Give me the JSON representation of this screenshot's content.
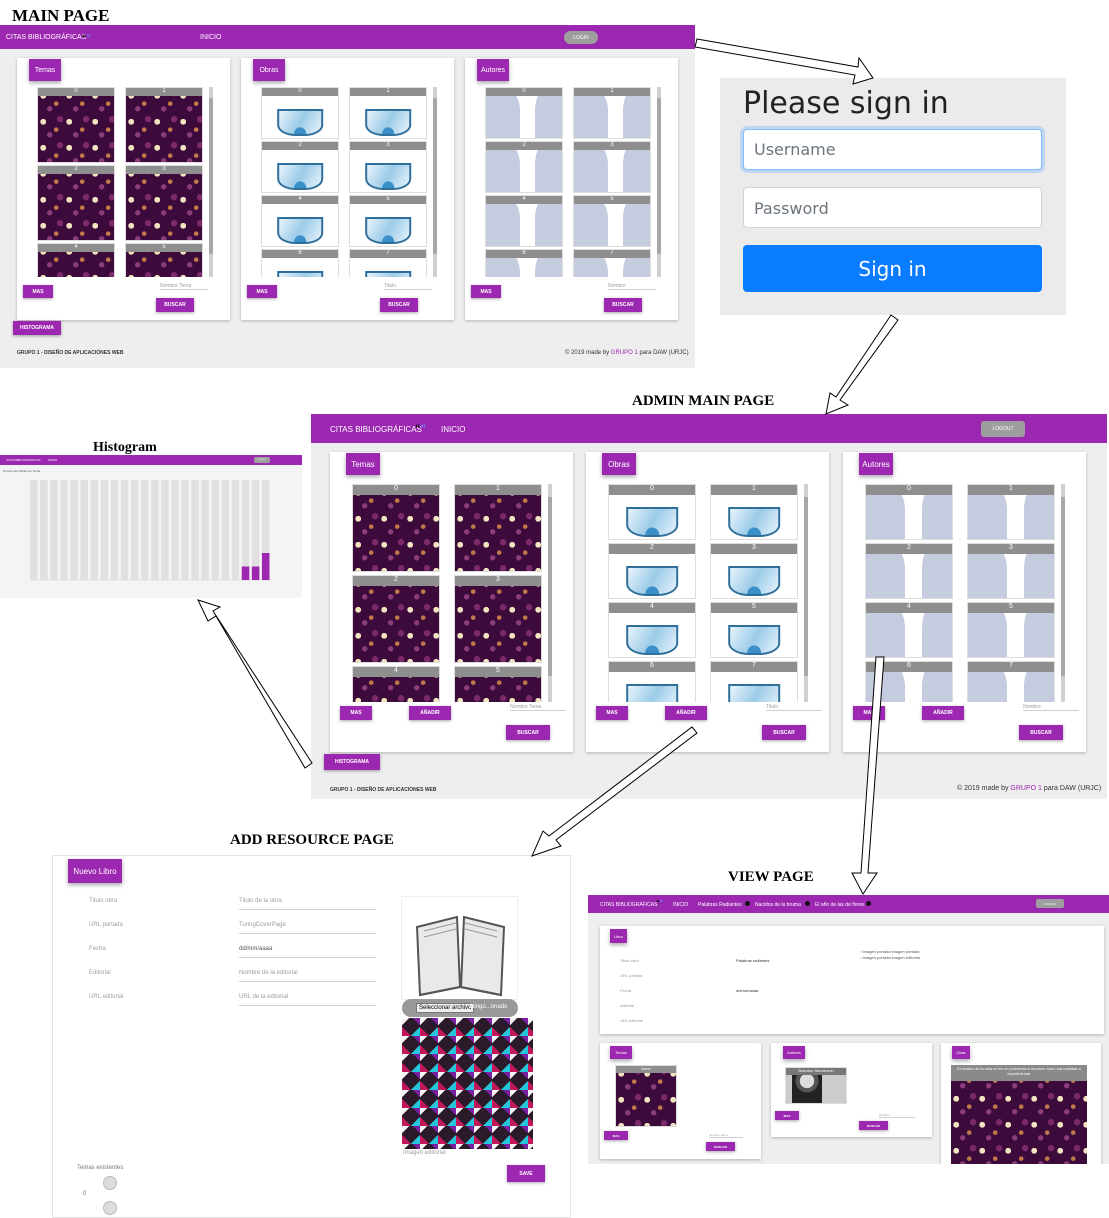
{
  "captions": {
    "main": "MAIN PAGE",
    "admin": "ADMIN MAIN PAGE",
    "histogram": "Histogram",
    "add": "ADD RESOURCE PAGE",
    "view": "VIEW PAGE"
  },
  "main_page": {
    "brand": "CITAS BIBLIOGRÁFICAS",
    "quote_open": "“",
    "quote_close": "”",
    "nav_inicio": "INICIO",
    "login": "LOGIN",
    "cards": [
      {
        "chip": "Temas",
        "more": "MAS",
        "placeholder": "Nombre Tema",
        "search": "BUSCAR",
        "tiles": [
          "0",
          "1",
          "2",
          "3",
          "4",
          "5"
        ]
      },
      {
        "chip": "Obras",
        "more": "MAS",
        "placeholder": "Titulo",
        "search": "BUSCAR",
        "tiles": [
          "0",
          "1",
          "2",
          "3",
          "4",
          "5",
          "6",
          "7"
        ]
      },
      {
        "chip": "Autores",
        "more": "MAS",
        "placeholder": "Nombre",
        "search": "BUSCAR",
        "tiles": [
          "0",
          "1",
          "2",
          "3",
          "4",
          "5",
          "6",
          "7"
        ]
      }
    ],
    "histogram_btn": "HISTOGRAMA",
    "footer_left": "GRUPO 1 - DISEÑO DE APLICACIONES WEB",
    "footer_right_pre": "© 2019 made by",
    "footer_right_link": "GRUPO 1",
    "footer_right_post": "para DAW (URJC)"
  },
  "login": {
    "title": "Please sign in",
    "username_placeholder": "Username",
    "password_placeholder": "Password",
    "button": "Sign in",
    "colors": {
      "button": "#0a7cff",
      "focus": "#80bdff"
    }
  },
  "admin_page": {
    "brand": "CITAS BIBLIOGRÁFICAS",
    "nav_inicio": "INICIO",
    "logout": "LOGOUT",
    "cards": [
      {
        "chip": "Temas",
        "more": "MAS",
        "add": "AÑADIR",
        "placeholder": "Nombre Tema",
        "search": "BUSCAR",
        "tiles": [
          "0",
          "1",
          "2",
          "3",
          "4",
          "5"
        ]
      },
      {
        "chip": "Obras",
        "more": "MAS",
        "add": "AÑADIR",
        "placeholder": "Titulo",
        "search": "BUSCAR",
        "tiles": [
          "0",
          "1",
          "2",
          "3",
          "4",
          "5",
          "6",
          "7"
        ]
      },
      {
        "chip": "Autores",
        "more": "MAS",
        "add": "AÑADIR",
        "placeholder": "Nombre",
        "search": "BUSCAR",
        "tiles": [
          "0",
          "1",
          "2",
          "3",
          "4",
          "5",
          "6",
          "7"
        ]
      }
    ],
    "histogram_btn": "HISTOGRAMA",
    "footer_left": "GRUPO 1 - DISEÑO DE APLICACIONES WEB",
    "footer_right_pre": "© 2019 made by",
    "footer_right_link": "GRUPO 1",
    "footer_right_post": "para DAW (URJC)"
  },
  "histogram_page": {
    "brand": "CITAS BIBLIOGRÁFICAS",
    "nav_inicio": "INICIO",
    "logout": "LOGOUT",
    "ylabel": "Número de Obras por Tema",
    "chart_data": {
      "type": "bar",
      "bars": 24,
      "values_relative": [
        0,
        0,
        0,
        0,
        0,
        0,
        0,
        0,
        0,
        0,
        0,
        0,
        0,
        0,
        0,
        0,
        0,
        0,
        0,
        0,
        0,
        0.3,
        0.3,
        0.6
      ],
      "background_bar_color": "#e0e0e0",
      "value_bar_color": "#9c27b0"
    }
  },
  "add_page": {
    "chip": "Nuevo Libro",
    "fields": [
      {
        "label": "Titulo obra",
        "placeholder": "Titulo de la obra"
      },
      {
        "label": "URL portada",
        "placeholder": "TuringCoverPage"
      },
      {
        "label": "Fecha",
        "placeholder": "dd/mm/aaaa"
      },
      {
        "label": "Editorial",
        "placeholder": "Nombre de la editorial"
      },
      {
        "label": "URL editorial",
        "placeholder": "URL de la editorial"
      }
    ],
    "file_button": "Seleccionar archivo",
    "file_status": "Ningú...onado",
    "image_caption": "Imagen editorial",
    "temas_label": "Temas existentes",
    "temas_count": "0",
    "save": "SAVE"
  },
  "view_page": {
    "brand": "CITAS BIBLIOGRÁFICAS",
    "nav_inicio": "INICIO",
    "nav_items": [
      "Palabras Radiantes",
      "Nacidos de la bruma",
      "El año de las de flores"
    ],
    "logout": "LOGOUT",
    "libro_chip": "Libro",
    "libro_labels": [
      "Titulo obra",
      "URL portada",
      "Fecha",
      "editorial",
      "URL editorial"
    ],
    "libro_values": [
      "Palabras radiantes",
      "",
      "dd/mm/aaaa"
    ],
    "image_alt_1": "Imagen portada imagen portada",
    "image_alt_2": "Imagen portada imagen editorial",
    "temas_chip": "Temas",
    "tema_tile": "Amor",
    "autores_chip": "Autores",
    "autor_tile": "Brandon Sanderson",
    "citas_chip": "Citas",
    "cita_text": "El motivo de la vida no es un problema a resolver, sino una realidad a experimentar",
    "more": "MAS",
    "search": "BUSCAR",
    "placeholder_temas": "Nombre Tema",
    "placeholder_autores": "Nombre"
  }
}
